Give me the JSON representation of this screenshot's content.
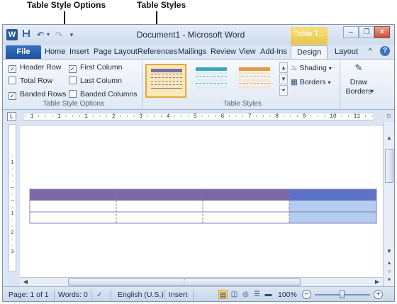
{
  "callouts": {
    "table_style_options": "Table Style Options",
    "table_styles": "Table Styles"
  },
  "window": {
    "title": "Document1 - Microsoft Word",
    "tools_tab": "Table T...",
    "minimize": "–",
    "restore": "❐",
    "close": "✕"
  },
  "qat": {
    "word_icon": "W",
    "save_icon": "floppy-disk",
    "undo_icon": "undo-arrow",
    "redo_icon": "redo-arrow",
    "customize_icon": "dropdown"
  },
  "tabs": [
    {
      "label": "File"
    },
    {
      "label": "Home"
    },
    {
      "label": "Insert"
    },
    {
      "label": "Page Layout"
    },
    {
      "label": "References"
    },
    {
      "label": "Mailings"
    },
    {
      "label": "Review"
    },
    {
      "label": "View"
    },
    {
      "label": "Add-Ins"
    },
    {
      "label": "Design"
    },
    {
      "label": "Layout"
    }
  ],
  "ribbon": {
    "style_options": {
      "items": [
        {
          "label": "Header Row",
          "checked": true
        },
        {
          "label": "First Column",
          "checked": true
        },
        {
          "label": "Total Row",
          "checked": false
        },
        {
          "label": "Last Column",
          "checked": false
        },
        {
          "label": "Banded Rows",
          "checked": true
        },
        {
          "label": "Banded Columns",
          "checked": false
        }
      ],
      "group_label": "Table Style Options"
    },
    "table_styles": {
      "group_label": "Table Styles",
      "thumbnails": [
        {
          "name": "purple",
          "header_color": "#7b6aa8",
          "band_color": "#ffffff",
          "selected": true
        },
        {
          "name": "teal",
          "header_color": "#3fa7b8",
          "band_color": "#d7eff3",
          "selected": false
        },
        {
          "name": "orange",
          "header_color": "#e79a45",
          "band_color": "#fbe3c8",
          "selected": false
        }
      ],
      "shading_label": "Shading",
      "borders_label": "Borders"
    },
    "draw_borders": {
      "label_line1": "Draw",
      "label_line2": "Borders"
    }
  },
  "ruler": {
    "corner": "L",
    "marks": "· 1 · · · 1 · · · 1 · · · 2 · · · 3 · · · 4 · · · 5 · · · 6 · · · 7 · · · 8 · · · 9 · · · 10 · · 11 · · 12 · · 13 · · 14"
  },
  "document_table": {
    "header_color": "#7b68a6",
    "selected_header_color": "#5b73c4",
    "selected_cell_color": "#b4cdf0",
    "border_color": "#8a7bb8",
    "rows": 3,
    "columns": 4
  },
  "status": {
    "page": "Page: 1 of 1",
    "words": "Words: 0",
    "language": "English (U.S.)",
    "mode": "Insert",
    "zoom": "100%",
    "zoom_level": 0.5,
    "minus": "−",
    "plus": "+"
  }
}
